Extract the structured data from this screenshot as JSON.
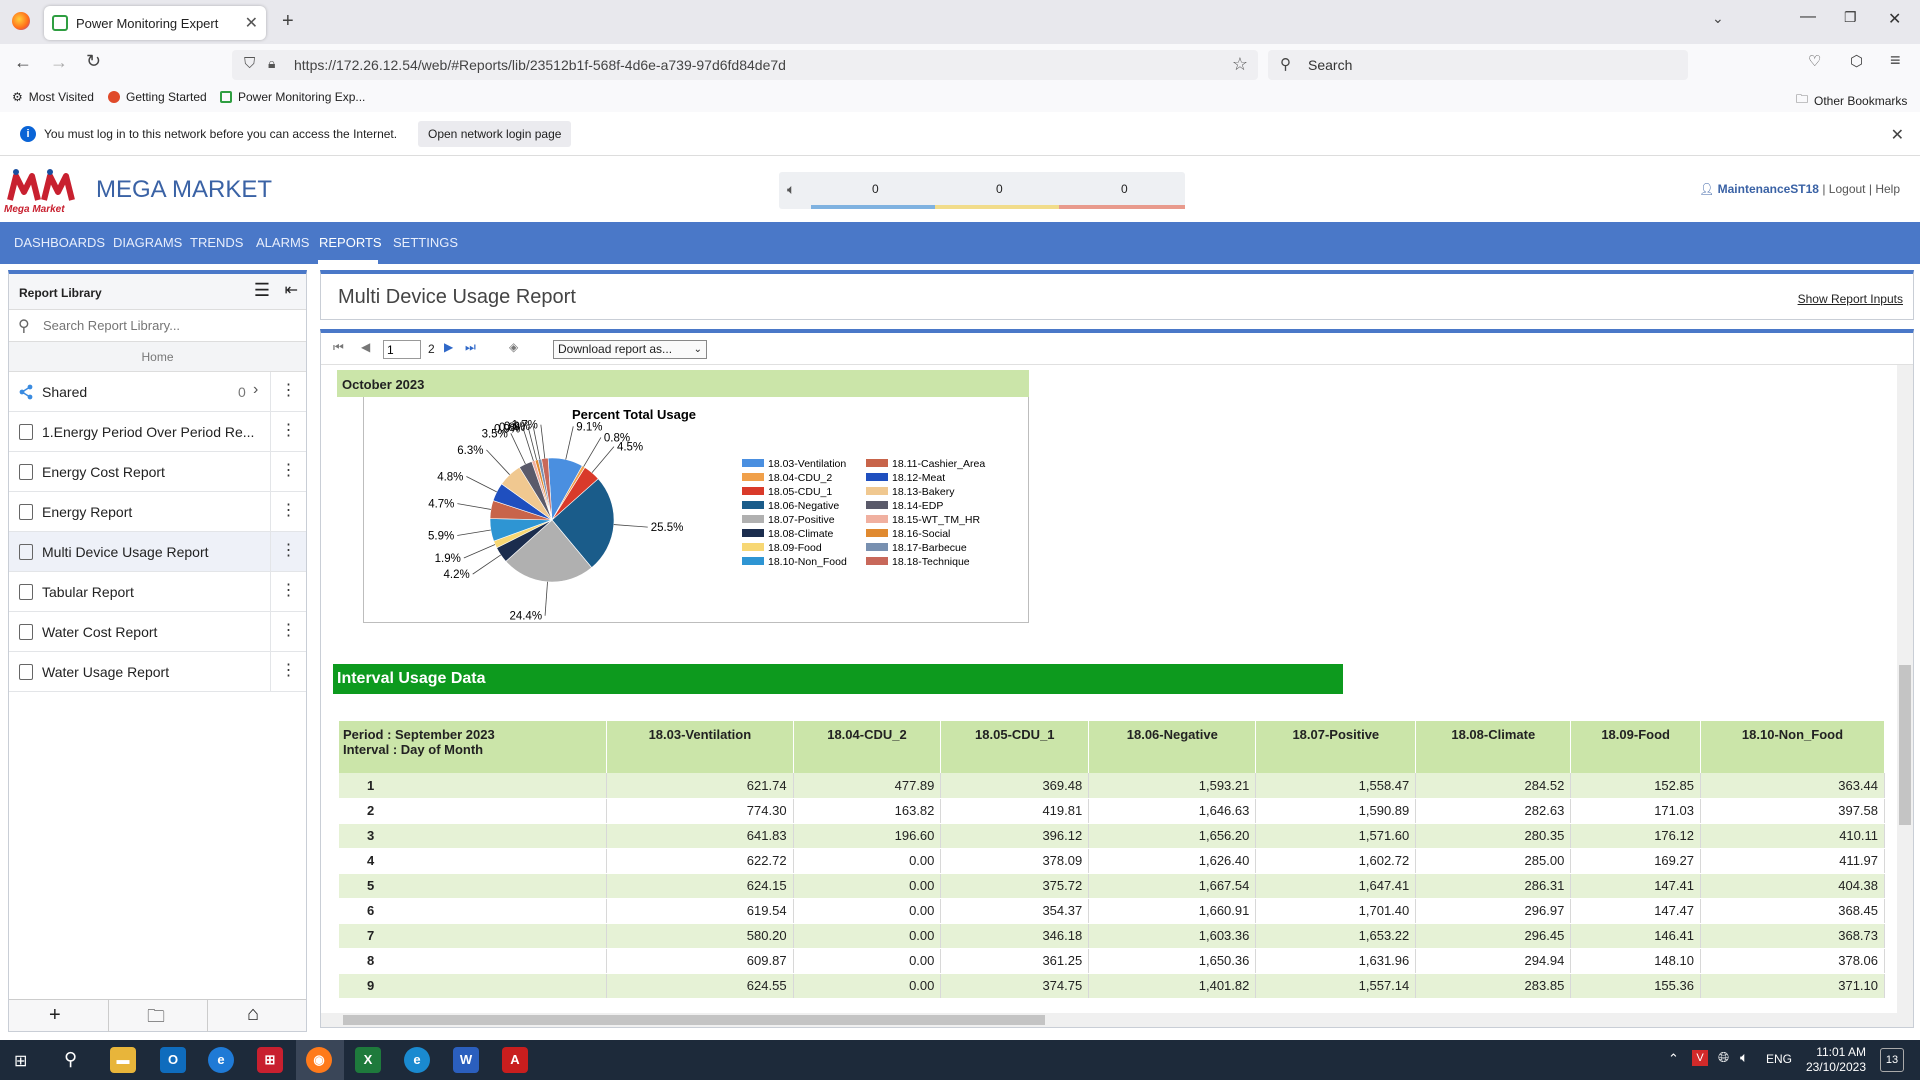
{
  "browser": {
    "tab_title": "Power Monitoring Expert",
    "url": "https://172.26.12.54/web/#Reports/lib/23512b1f-568f-4d6e-a739-97d6fd84de7d",
    "search_placeholder": "Search",
    "bookmarks": [
      "Most Visited",
      "Getting Started",
      "Power Monitoring Exp...",
      "Other Bookmarks"
    ],
    "notice_text": "You must log in to this network before you can access the Internet.",
    "notice_button": "Open network login page"
  },
  "app": {
    "brand": "MEGA MARKET",
    "logo_caption": "Mega Market",
    "alarm_counts": [
      "0",
      "0",
      "0"
    ],
    "alarm_colors": [
      "#7fb2e0",
      "#f1dc8a",
      "#e89a8c"
    ],
    "user": "MaintenanceST18",
    "logout": "Logout",
    "help": "Help",
    "separator": "|",
    "nav": [
      "DASHBOARDS",
      "DIAGRAMS",
      "TRENDS",
      "ALARMS",
      "REPORTS",
      "SETTINGS"
    ]
  },
  "sidebar": {
    "title": "Report Library",
    "search_placeholder": "Search Report Library...",
    "home": "Home",
    "shared": {
      "label": "Shared",
      "count": "0"
    },
    "items": [
      "1.Energy Period Over Period Re...",
      "Energy Cost Report",
      "Energy Report",
      "Multi Device Usage Report",
      "Tabular Report",
      "Water Cost Report",
      "Water Usage Report"
    ]
  },
  "report": {
    "title": "Multi Device Usage Report",
    "show_inputs": "Show Report Inputs",
    "page": "1",
    "total_pages": "2",
    "download": "Download report as...",
    "month_band": "October 2023",
    "section_title": "Interval Usage Data"
  },
  "chart_data": {
    "type": "pie",
    "title": "Percent Total Usage",
    "unit": "%",
    "slices": [
      {
        "label": "18.03-Ventilation",
        "value": 9.1,
        "color": "#4a8fe0"
      },
      {
        "label": "18.04-CDU_2",
        "value": 0.8,
        "color": "#f0a04a"
      },
      {
        "label": "18.05-CDU_1",
        "value": 4.5,
        "color": "#d93a2a"
      },
      {
        "label": "18.06-Negative",
        "value": 25.5,
        "color": "#1a5c8a"
      },
      {
        "label": "18.07-Positive",
        "value": 24.4,
        "color": "#b0b0b0"
      },
      {
        "label": "18.08-Climate",
        "value": 4.2,
        "color": "#1b2d4e"
      },
      {
        "label": "18.09-Food",
        "value": 1.9,
        "color": "#f7d774"
      },
      {
        "label": "18.10-Non_Food",
        "value": 5.9,
        "color": "#2e95d3"
      },
      {
        "label": "18.11-Cashier_Area",
        "value": 4.7,
        "color": "#c8644a"
      },
      {
        "label": "18.12-Meat",
        "value": 4.8,
        "color": "#1f4fbf"
      },
      {
        "label": "18.13-Bakery",
        "value": 6.3,
        "color": "#f0c890"
      },
      {
        "label": "18.14-EDP",
        "value": 3.5,
        "color": "#5a5a6a"
      },
      {
        "label": "18.15-WT_TM_HR",
        "value": 0.9,
        "color": "#f0b0a0"
      },
      {
        "label": "18.16-Social",
        "value": 0.8,
        "color": "#e08a30"
      },
      {
        "label": "18.17-Barbecue",
        "value": 0.9,
        "color": "#7890b0"
      },
      {
        "label": "18.18-Technique",
        "value": 1.7,
        "color": "#c8685a"
      }
    ]
  },
  "table": {
    "period_label": "Period : September 2023",
    "interval_label": "Interval : Day of Month",
    "columns": [
      "18.03-Ventilation",
      "18.04-CDU_2",
      "18.05-CDU_1",
      "18.06-Negative",
      "18.07-Positive",
      "18.08-Climate",
      "18.09-Food",
      "18.10-Non_Food"
    ],
    "rows": [
      [
        "1",
        "621.74",
        "477.89",
        "369.48",
        "1,593.21",
        "1,558.47",
        "284.52",
        "152.85",
        "363.44"
      ],
      [
        "2",
        "774.30",
        "163.82",
        "419.81",
        "1,646.63",
        "1,590.89",
        "282.63",
        "171.03",
        "397.58"
      ],
      [
        "3",
        "641.83",
        "196.60",
        "396.12",
        "1,656.20",
        "1,571.60",
        "280.35",
        "176.12",
        "410.11"
      ],
      [
        "4",
        "622.72",
        "0.00",
        "378.09",
        "1,626.40",
        "1,602.72",
        "285.00",
        "169.27",
        "411.97"
      ],
      [
        "5",
        "624.15",
        "0.00",
        "375.72",
        "1,667.54",
        "1,647.41",
        "286.31",
        "147.41",
        "404.38"
      ],
      [
        "6",
        "619.54",
        "0.00",
        "354.37",
        "1,660.91",
        "1,701.40",
        "296.97",
        "147.47",
        "368.45"
      ],
      [
        "7",
        "580.20",
        "0.00",
        "346.18",
        "1,603.36",
        "1,653.22",
        "296.45",
        "146.41",
        "368.73"
      ],
      [
        "8",
        "609.87",
        "0.00",
        "361.25",
        "1,650.36",
        "1,631.96",
        "294.94",
        "148.10",
        "378.06"
      ],
      [
        "9",
        "624.55",
        "0.00",
        "374.75",
        "1,401.82",
        "1,557.14",
        "283.85",
        "155.36",
        "371.10"
      ]
    ]
  },
  "taskbar": {
    "time": "11:01 AM",
    "date": "23/10/2023",
    "lang": "ENG",
    "notifications": "13",
    "apps": [
      "file-explorer",
      "outlook",
      "edge-legacy",
      "app",
      "firefox",
      "excel",
      "edge",
      "word",
      "acrobat"
    ]
  }
}
